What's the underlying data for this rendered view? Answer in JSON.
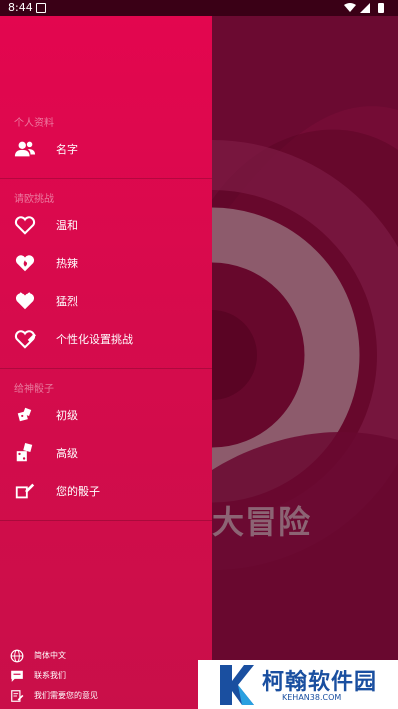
{
  "status_bar": {
    "time": "8:44"
  },
  "background": {
    "title": "大冒险"
  },
  "drawer": {
    "sections": [
      {
        "header": "个人资料",
        "items": [
          {
            "label": "名字",
            "icon": "people-icon"
          }
        ]
      },
      {
        "header": "请欧挑战",
        "items": [
          {
            "label": "温和",
            "icon": "heart-outline-icon"
          },
          {
            "label": "热辣",
            "icon": "heart-fire-icon"
          },
          {
            "label": "猛烈",
            "icon": "heart-filled-icon"
          },
          {
            "label": "个性化设置挑战",
            "icon": "heart-edit-icon"
          }
        ]
      },
      {
        "header": "给神骰子",
        "items": [
          {
            "label": "初级",
            "icon": "dice-small-icon"
          },
          {
            "label": "高级",
            "icon": "dice-large-icon"
          },
          {
            "label": "您的骰子",
            "icon": "dice-edit-icon"
          }
        ]
      }
    ],
    "footer": [
      {
        "label": "简体中文",
        "icon": "globe-icon"
      },
      {
        "label": "联系我们",
        "icon": "chat-icon"
      },
      {
        "label": "我们需要您的意见",
        "icon": "feedback-icon"
      }
    ]
  },
  "watermark": {
    "text": "柯翰软件园",
    "url": "KEHAN38.COM",
    "color": "#1a4fa0"
  },
  "colors": {
    "drawer_top": "#e3064f",
    "drawer_bottom": "#c90f49",
    "background": "#6a0830"
  }
}
